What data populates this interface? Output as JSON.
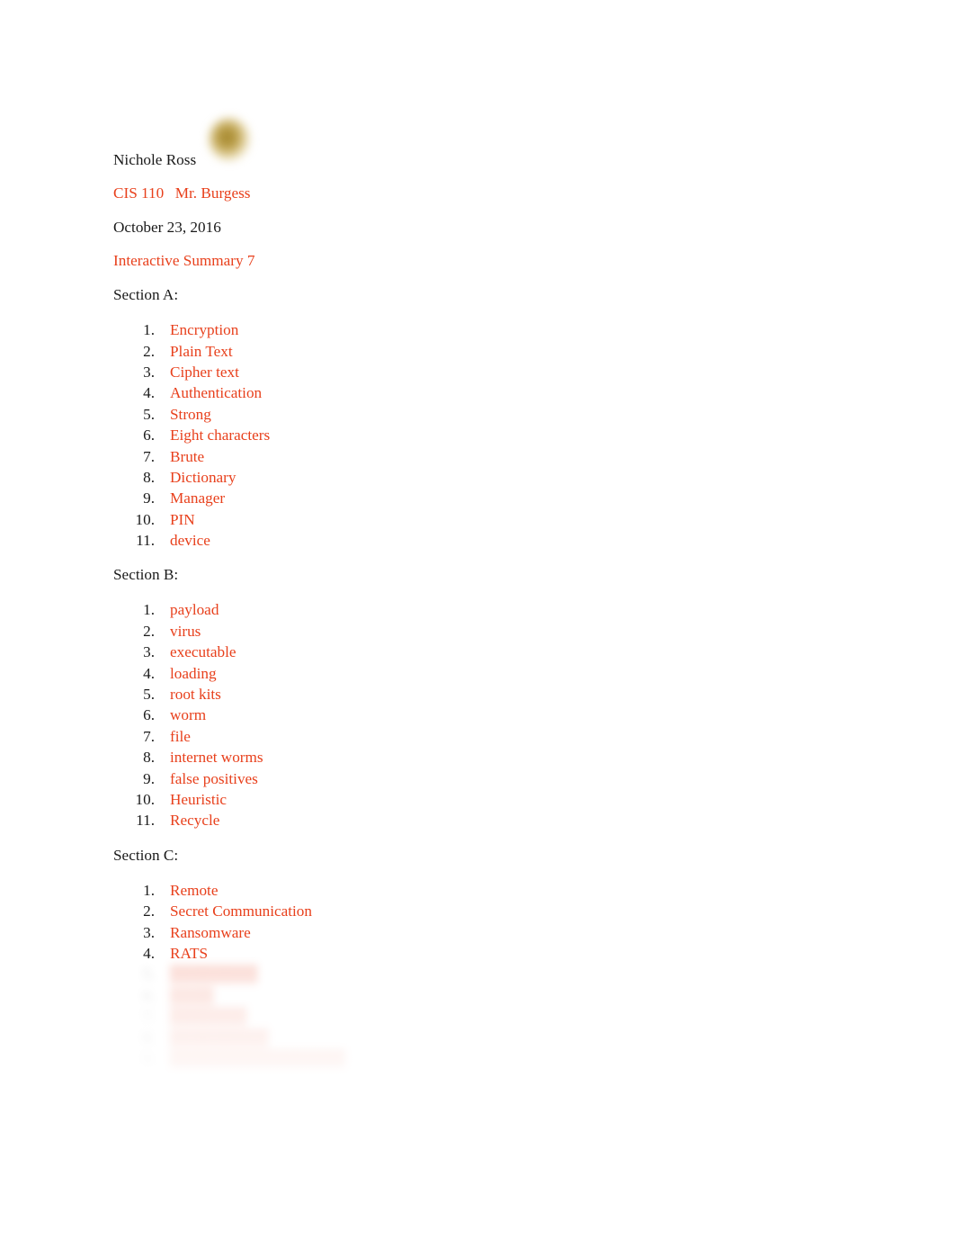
{
  "document": {
    "type": "word-processing-document",
    "background_color": "#ffffff",
    "accent_color": "#e8401c",
    "body_color": "#1a1a1a",
    "decoration": {
      "name": "blurred-gold-blob",
      "color": "#967614"
    }
  },
  "header": {
    "author": "Nichole Ross",
    "course_line": "CIS 110\tMr. Burgess",
    "date": "October 23, 2016",
    "assignment_title": "Interactive Summary 7"
  },
  "sections": [
    {
      "heading": "Section A:",
      "items": [
        "Encryption",
        "Plain Text",
        "Cipher text",
        "Authentication",
        "Strong",
        "Eight characters",
        "Brute",
        "Dictionary",
        "Manager",
        "PIN",
        "device"
      ]
    },
    {
      "heading": "Section B:",
      "items": [
        "payload",
        "virus",
        "executable",
        "loading",
        "root kits",
        "worm",
        "file",
        "internet worms",
        "false positives",
        "Heuristic",
        "Recycle"
      ]
    },
    {
      "heading": "Section C:",
      "items": [
        "Remote",
        "Secret Communication",
        "Ransomware",
        "RATS"
      ],
      "faded_items": [
        "████████",
        "████",
        "███████",
        "█████████",
        "████████████████"
      ]
    }
  ]
}
